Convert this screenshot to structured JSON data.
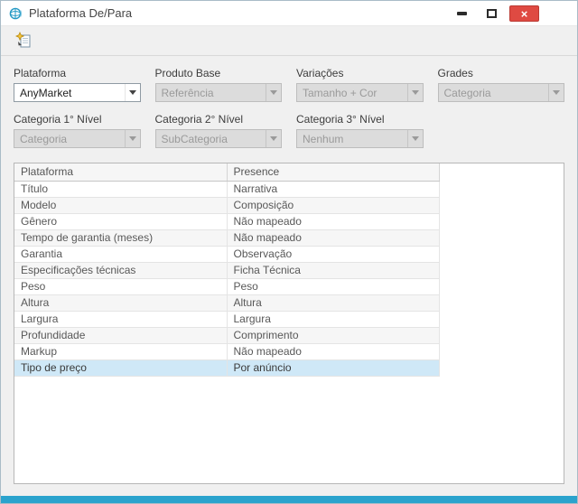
{
  "window": {
    "title": "Plataforma De/Para",
    "icon": "globe-sync-icon",
    "controls": {
      "minimize": "minimize",
      "maximize": "maximize",
      "close_glyph": "×"
    }
  },
  "toolbar": {
    "new_button_icon": "new-document-sparkle-icon"
  },
  "form": {
    "fields": [
      {
        "label": "Plataforma",
        "value": "AnyMarket",
        "enabled": true
      },
      {
        "label": "Produto Base",
        "value": "Referência",
        "enabled": false
      },
      {
        "label": "Variações",
        "value": "Tamanho + Cor",
        "enabled": false
      },
      {
        "label": "Grades",
        "value": "Categoria",
        "enabled": false
      },
      {
        "label": "Categoria 1° Nível",
        "value": "Categoria",
        "enabled": false
      },
      {
        "label": "Categoria 2° Nível",
        "value": "SubCategoria",
        "enabled": false
      },
      {
        "label": "Categoria 3° Nível",
        "value": "Nenhum",
        "enabled": false
      }
    ]
  },
  "table": {
    "columns": [
      "Plataforma",
      "Presence"
    ],
    "rows": [
      [
        "Título",
        "Narrativa"
      ],
      [
        "Modelo",
        "Composição"
      ],
      [
        "Gênero",
        "Não mapeado"
      ],
      [
        "Tempo de garantia (meses)",
        "Não mapeado"
      ],
      [
        "Garantia",
        "Observação"
      ],
      [
        "Especificações técnicas",
        "Ficha Técnica"
      ],
      [
        "Peso",
        "Peso"
      ],
      [
        "Altura",
        "Altura"
      ],
      [
        "Largura",
        "Largura"
      ],
      [
        "Profundidade",
        "Comprimento"
      ],
      [
        "Markup",
        "Não mapeado"
      ],
      [
        "Tipo de preço",
        "Por anúncio"
      ]
    ],
    "selected_row_index": 11,
    "selected_row": "Tipo de preço"
  },
  "colors": {
    "accent": "#2ba3cd",
    "close_red": "#df4a42",
    "selected_row_bg": "#cfe8f7",
    "disabled_bg": "#dcdcdc",
    "window_bg": "#f0f0f0",
    "titlebar_bg": "#ffffff"
  }
}
